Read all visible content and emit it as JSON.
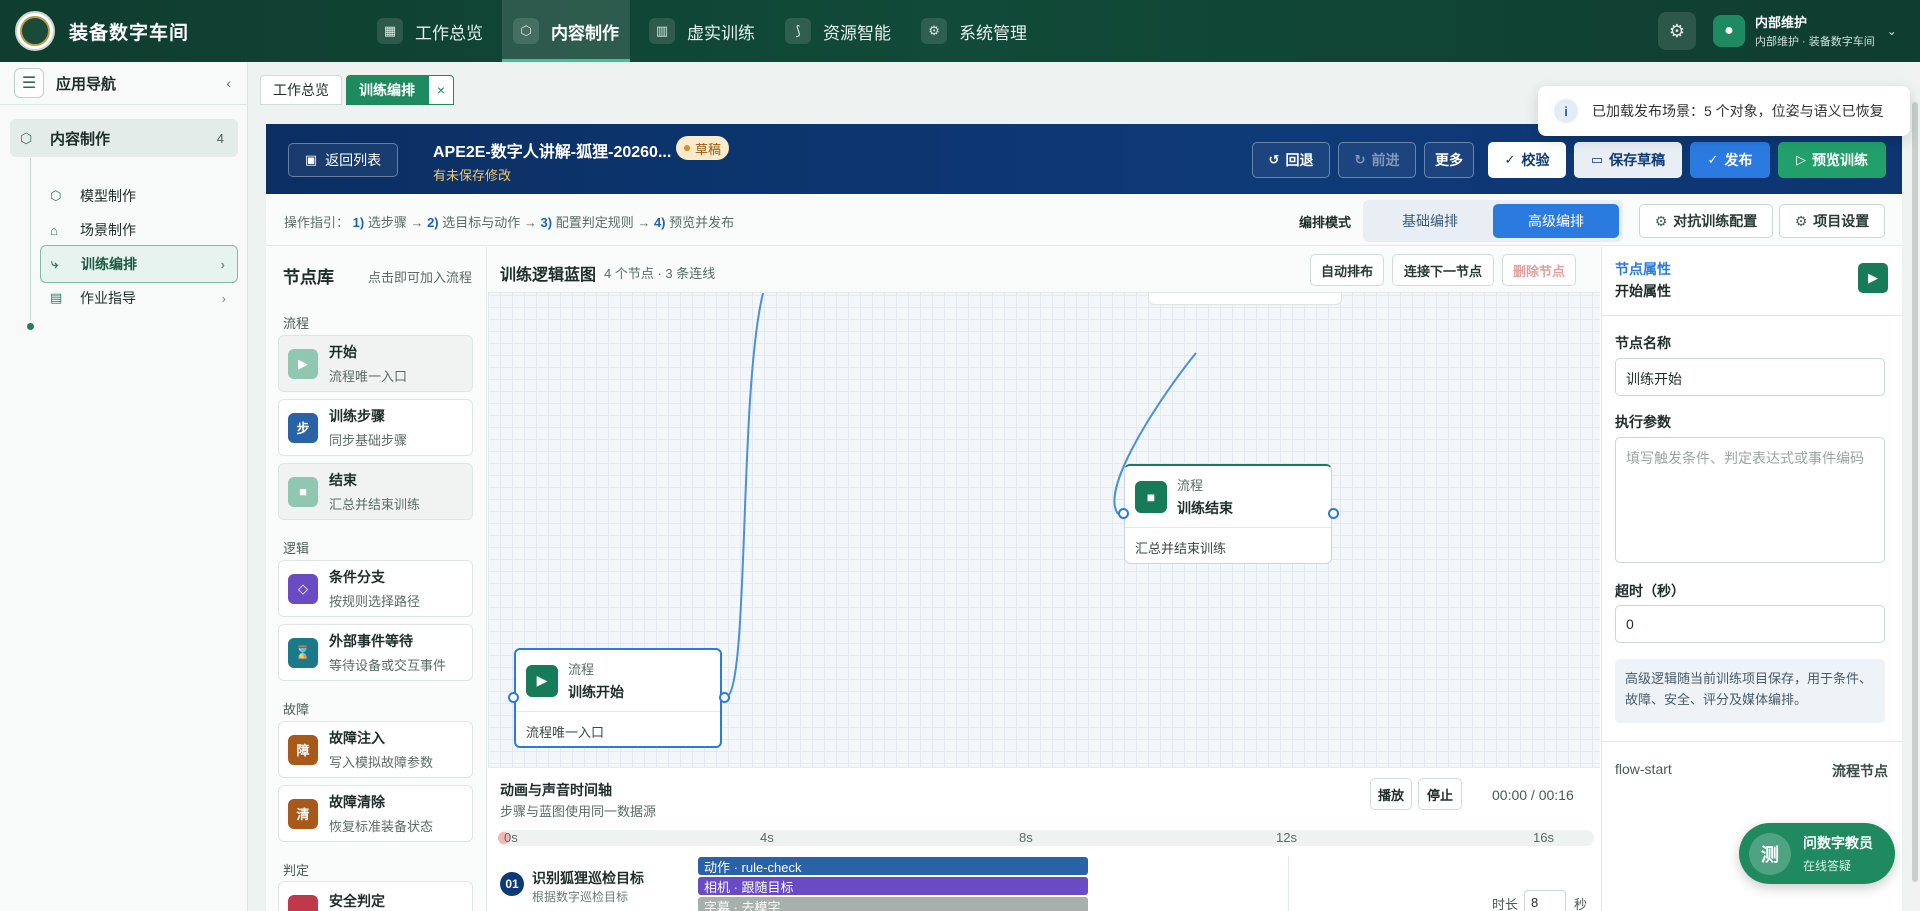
{
  "app": {
    "brand": "装备数字车间"
  },
  "nav": [
    {
      "label": "工作总览",
      "icon": "grid-icon"
    },
    {
      "label": "内容制作",
      "icon": "cube-icon",
      "active": true
    },
    {
      "label": "虚实训练",
      "icon": "book-icon"
    },
    {
      "label": "资源智能",
      "icon": "route-icon"
    },
    {
      "label": "系统管理",
      "icon": "gear-icon"
    }
  ],
  "user": {
    "name": "内部维护",
    "sub": "内部维护 · 装备数字车间",
    "avatar": "user-icon"
  },
  "sidebar": {
    "title": "应用导航",
    "group": {
      "label": "内容制作",
      "count": "4"
    },
    "items": [
      {
        "label": "模型制作",
        "icon": "cube-icon"
      },
      {
        "label": "场景制作",
        "icon": "building-icon"
      },
      {
        "label": "训练编排",
        "icon": "flow-icon",
        "active": true
      },
      {
        "label": "作业指导",
        "icon": "document-icon"
      }
    ]
  },
  "tabs": {
    "overview": "工作总览",
    "active": "训练编排",
    "close": "×"
  },
  "toast": {
    "icon": "i",
    "text": "已加载发布场景：5 个对象，位姿与语义已恢复"
  },
  "header": {
    "back": "返回列表",
    "title": "APE2E-数字人讲解-狐狸-20260...",
    "badge": "草稿",
    "unsaved": "有未保存修改",
    "undo": "回退",
    "redo": "前进",
    "more": "更多",
    "validate": "校验",
    "save": "保存草稿",
    "publish": "发布",
    "preview": "预览训练"
  },
  "guide": {
    "prefix": "操作指引：",
    "s1n": "1)",
    "s1": "选步骤 →",
    "s2n": "2)",
    "s2": "选目标与动作 →",
    "s3n": "3)",
    "s3": "配置判定规则 →",
    "s4n": "4)",
    "s4": "预览并发布",
    "mode_label": "编排模式",
    "mode_basic": "基础编排",
    "mode_advanced": "高级编排",
    "adversarial": "对抗训练配置",
    "project": "项目设置"
  },
  "library": {
    "title": "节点库",
    "hint": "点击即可加入流程",
    "cat_flow": "流程",
    "cat_logic": "逻辑",
    "cat_fault": "故障",
    "cat_judge": "判定",
    "nodes": [
      {
        "name": "开始",
        "desc": "流程唯一入口",
        "icon": "▶",
        "color": "#8fc7b0"
      },
      {
        "name": "训练步骤",
        "desc": "同步基础步骤",
        "icon": "步",
        "color": "#2a62a8"
      },
      {
        "name": "结束",
        "desc": "汇总并结束训练",
        "icon": "■",
        "color": "#8fc7b0"
      },
      {
        "name": "条件分支",
        "desc": "按规则选择路径",
        "icon": "◇",
        "color": "#6b4bc4"
      },
      {
        "name": "外部事件等待",
        "desc": "等待设备或交互事件",
        "icon": "⌛",
        "color": "#1a7a8a"
      },
      {
        "name": "故障注入",
        "desc": "写入模拟故障参数",
        "icon": "障",
        "color": "#a8591a"
      },
      {
        "name": "故障清除",
        "desc": "恢复标准装备状态",
        "icon": "清",
        "color": "#a8591a"
      },
      {
        "name": "安全判定",
        "desc": "",
        "icon": "",
        "color": "#c0394a"
      }
    ]
  },
  "canvas": {
    "title": "训练逻辑蓝图",
    "stats": "4 个节点 · 3 条连线",
    "auto": "自动排布",
    "connect": "连接下一节点",
    "delete": "删除节点",
    "node_start": {
      "kind": "流程",
      "name": "训练开始",
      "desc": "流程唯一入口"
    },
    "node_end": {
      "kind": "流程",
      "name": "训练结束",
      "desc": "汇总并结束训练"
    }
  },
  "timeline": {
    "title": "动画与声音时间轴",
    "sub": "步骤与蓝图使用同一数据源",
    "play": "播放",
    "stop": "停止",
    "time": "00:00 / 00:16",
    "ticks": [
      "0s",
      "4s",
      "8s",
      "12s",
      "16s"
    ],
    "row": {
      "num": "01",
      "title": "识别狐狸巡检目标",
      "sub": "根据数字巡检目标"
    },
    "tracks": [
      {
        "label": "动作 · rule-check",
        "color": "#2a62a8"
      },
      {
        "label": "相机 · 跟随目标",
        "color": "#6b4bc4"
      },
      {
        "label": "字幕 · 去模字",
        "color": "#a6b0ad"
      }
    ],
    "duration_label": "时长",
    "duration_value": "8",
    "duration_unit": "秒"
  },
  "props": {
    "kicker": "节点属性",
    "title": "开始属性",
    "name_label": "节点名称",
    "name_value": "训练开始",
    "params_label": "执行参数",
    "params_placeholder": "填写触发条件、判定表达式或事件编码",
    "timeout_label": "超时（秒）",
    "timeout_value": "0",
    "note": "高级逻辑随当前训练项目保存，用于条件、故障、安全、评分及媒体编排。",
    "flow_id": "flow-start",
    "flow_type": "流程节点"
  },
  "assistant": {
    "avatar": "测",
    "name": "问数字教员",
    "status": "在线答疑"
  }
}
